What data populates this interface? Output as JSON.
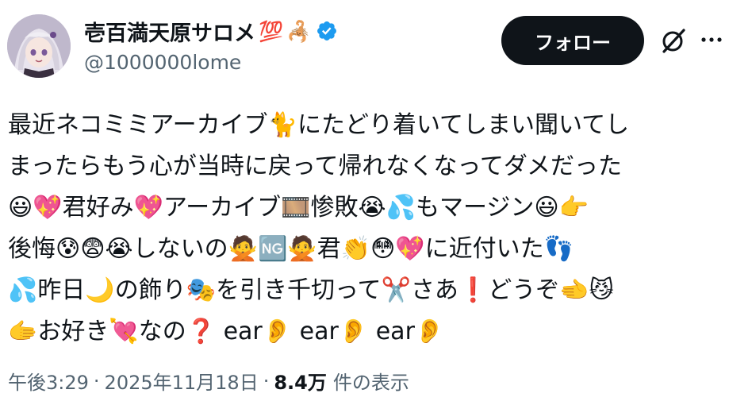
{
  "author": {
    "display_name": "壱百満天原サロメ",
    "name_emoji_1": "💯",
    "name_emoji_2": "🦂",
    "handle": "@1000000lome",
    "verified": true,
    "avatar_icon": "avatar-image"
  },
  "actions": {
    "follow_label": "フォロー",
    "grok_icon": "grok-icon",
    "more_icon": "more-icon"
  },
  "tweet": {
    "lines": [
      "最近ネコミミアーカイブ🐈にたどり着いてしまい聞いてし",
      "まったらもう心が当時に戻って帰れなくなってダメだった",
      "😃💖君好み💖アーカイブ🎞️惨敗😭💦もマージン😃👉",
      "後悔😰😨😭しないの🙅🆖🙅君👏😳💖に近付いた👣",
      "💦昨日🌙の飾り🎭を引き千切って✂️さあ❗どうぞ🫲😼",
      "🫱お好き💘なの❓ ear👂 ear👂 ear👂"
    ]
  },
  "meta": {
    "time": "午後3:29",
    "date": "2025年11月18日",
    "views_count": "8.4万",
    "views_label": "件の表示",
    "separator": "·"
  },
  "colors": {
    "text_primary": "#0f1419",
    "text_secondary": "#536471",
    "verified_blue": "#1d9bf0",
    "follow_bg": "#0f1419",
    "follow_text": "#ffffff"
  }
}
